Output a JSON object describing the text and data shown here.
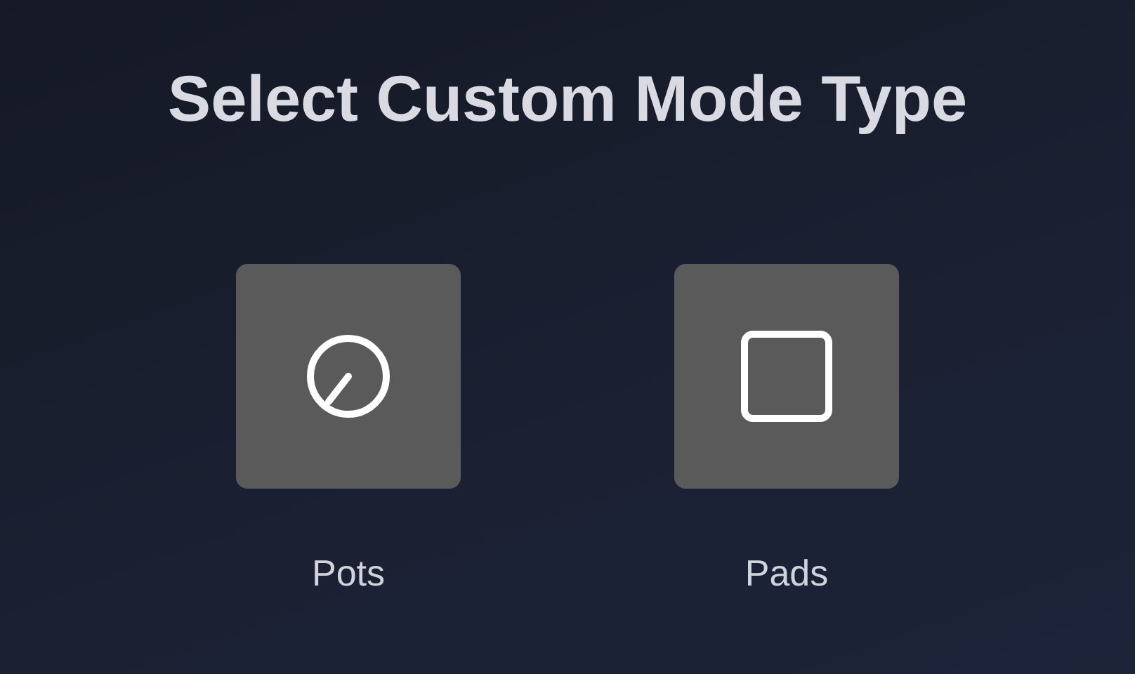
{
  "title": "Select Custom Mode Type",
  "options": [
    {
      "kind": "pots",
      "label": "Pots"
    },
    {
      "kind": "pads",
      "label": "Pads"
    }
  ]
}
